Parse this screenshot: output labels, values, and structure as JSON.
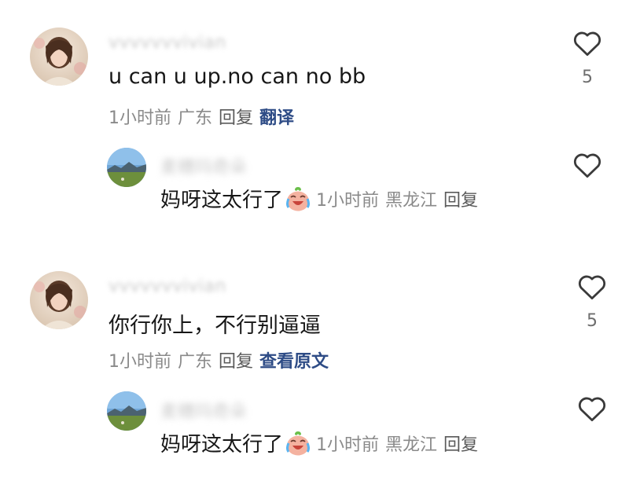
{
  "comments": [
    {
      "username": "vvvvvvvivian",
      "text": "u can u up.no can no bb",
      "time": "1小时前",
      "location": "广东",
      "reply_label": "回复",
      "action_label": "翻译",
      "like_count": "5",
      "reply": {
        "username": "麦穗玛奇朵",
        "text": "妈呀这太行了",
        "time": "1小时前",
        "location": "黑龙江",
        "reply_label": "回复"
      }
    },
    {
      "username": "vvvvvvvivian",
      "text": "你行你上，不行别逼逼",
      "time": "1小时前",
      "location": "广东",
      "reply_label": "回复",
      "action_label": "查看原文",
      "like_count": "5",
      "reply": {
        "username": "麦穗玛奇朵",
        "text": "妈呀这太行了",
        "time": "1小时前",
        "location": "黑龙江",
        "reply_label": "回复"
      }
    }
  ],
  "icons": {
    "like": "heart-outline-icon",
    "emoji": "crying-laughing-emoji"
  },
  "colors": {
    "text": "#171717",
    "meta": "#8a8a8a",
    "link": "#2e4c86",
    "heart": "#3a3a3a"
  }
}
